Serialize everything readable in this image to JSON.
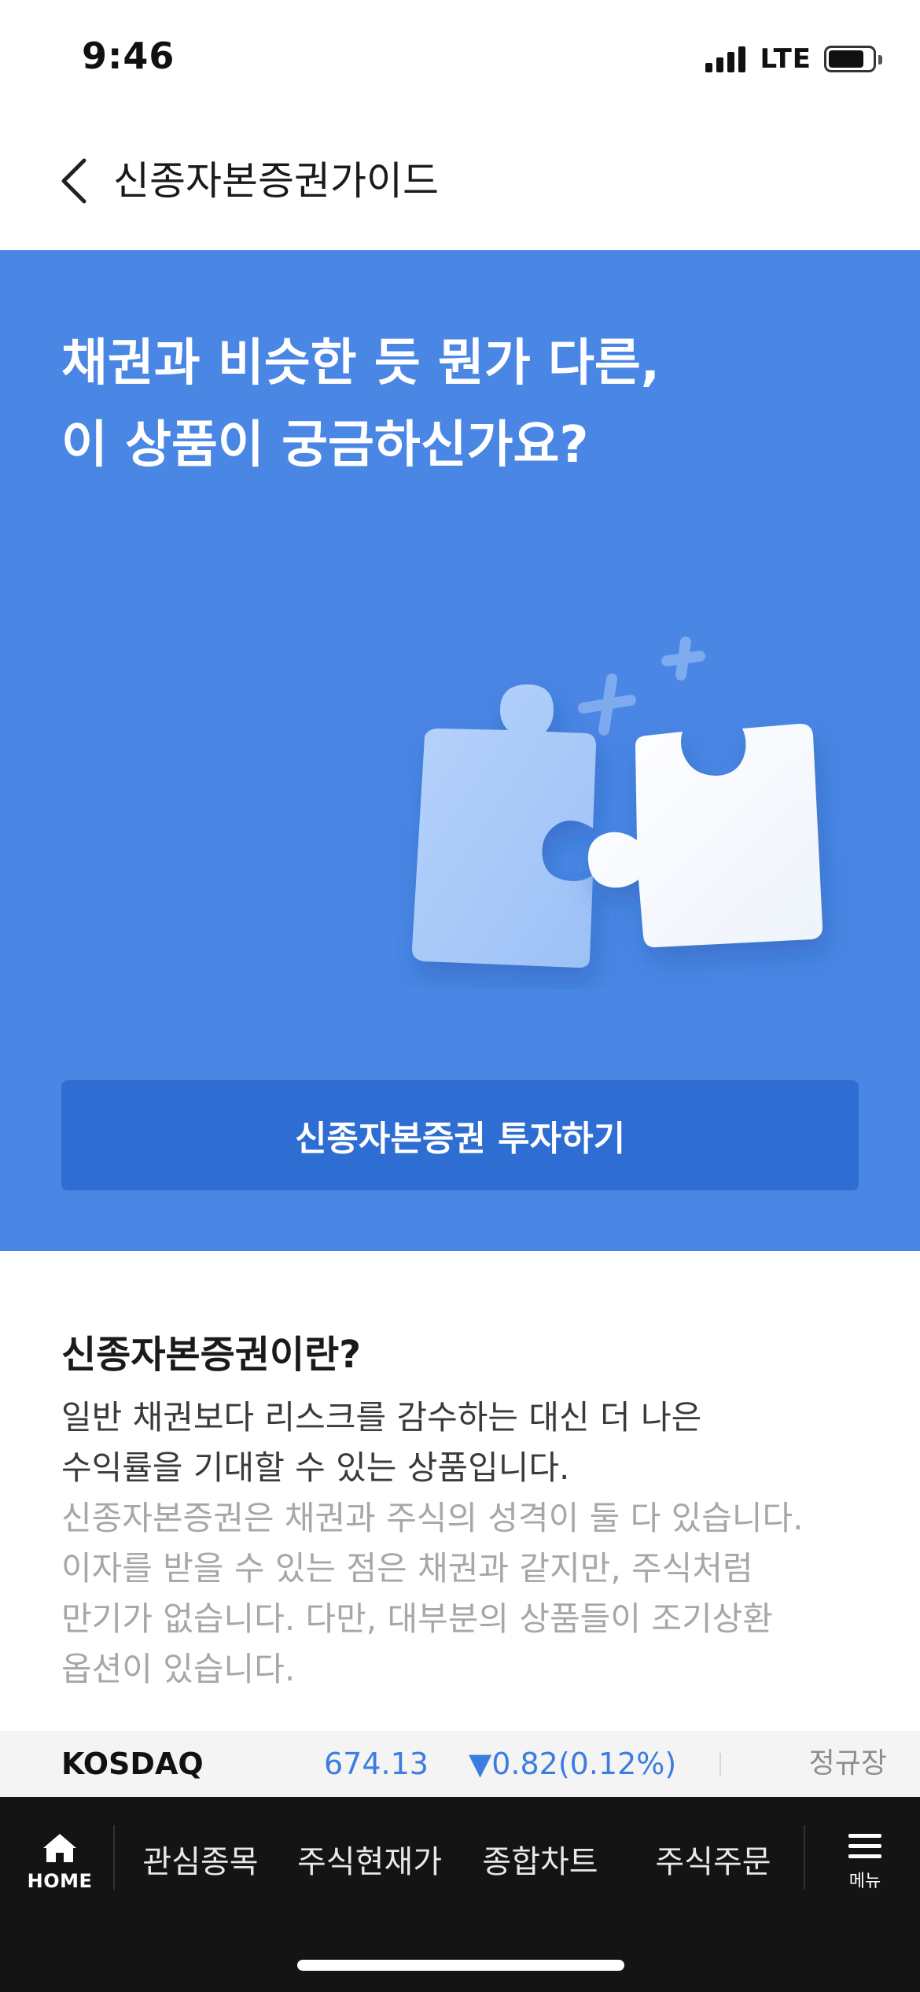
{
  "status_bar": {
    "time": "9:46",
    "network": "LTE"
  },
  "header": {
    "title": "신종자본증권가이드",
    "back_icon": "chevron-left-icon"
  },
  "hero": {
    "heading_line1": "채권과 비슷한 듯 뭔가 다른,",
    "heading_line2": "이 상품이 궁금하신가요?",
    "illustration": "puzzle-pieces-icon",
    "cta_label": "신종자본증권 투자하기",
    "background_color": "#4a86e4",
    "cta_color": "#2e6dd1"
  },
  "info": {
    "title": "신종자본증권이란?",
    "lead_line1": "일반 채권보다 리스크를 감수하는 대신 더 나은",
    "lead_line2": "수익률을 기대할 수 있는 상품입니다.",
    "body_line1": "신종자본증권은 채권과 주식의 성격이 둘 다 있습니다.",
    "body_line2": "이자를 받을 수 있는 점은 채권과 같지만, 주식처럼",
    "body_line3": "만기가 없습니다. 다만, 대부분의 상품들이 조기상환",
    "body_line4": "옵션이 있습니다."
  },
  "ticker": {
    "index_name": "KOSDAQ",
    "value": "674.13",
    "change": "▼0.82(0.12%)",
    "session": "정규장",
    "change_color": "#3b7de0"
  },
  "bottom_nav": {
    "home_label": "HOME",
    "items": [
      {
        "label": "관심종목"
      },
      {
        "label": "주식현재가"
      },
      {
        "label": "종합차트"
      },
      {
        "label": "주식주문"
      }
    ],
    "menu_label": "메뉴"
  }
}
